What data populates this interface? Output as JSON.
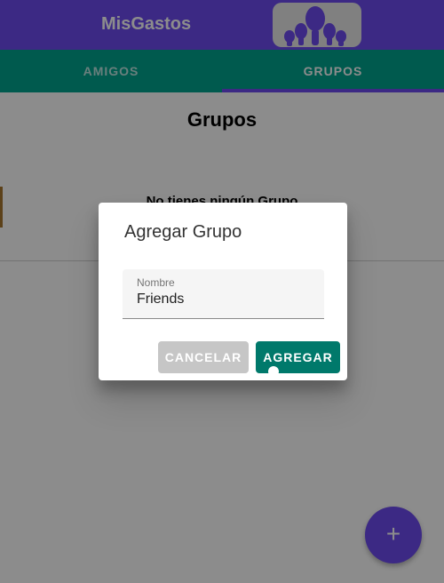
{
  "app": {
    "title": "MisGastos",
    "logo_icon": "people-group-logo-icon"
  },
  "tabs": [
    {
      "label": "AMIGOS",
      "selected": false
    },
    {
      "label": "GRUPOS",
      "selected": true
    }
  ],
  "page": {
    "title": "Grupos",
    "empty_message": "No tienes ningún Grupo"
  },
  "fab": {
    "label": "+"
  },
  "dialog": {
    "title": "Agregar Grupo",
    "field_label": "Nombre",
    "field_value": "Friends",
    "cancel_label": "CANCELAR",
    "add_label": "AGREGAR"
  },
  "colors": {
    "primary": "#6d4cf0",
    "tab_bar": "#00a58e",
    "add_button": "#00796b",
    "cancel_button": "#c6c6c6"
  }
}
